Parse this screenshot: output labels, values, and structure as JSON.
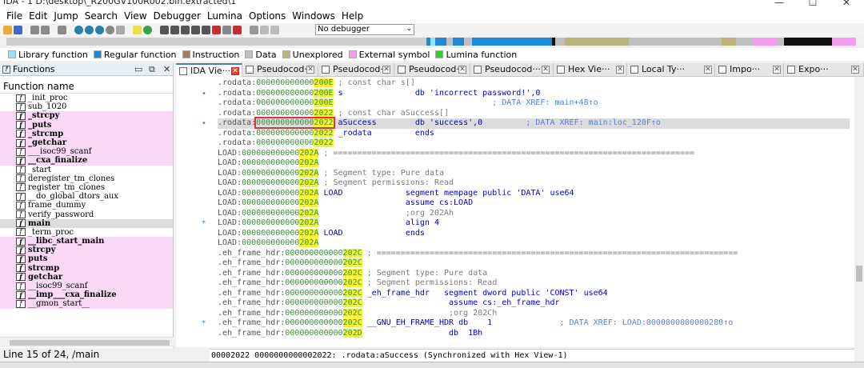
{
  "window": {
    "title": "IDA - 1 D:\\desktop\\_R200GV100R002.bin.extracted\\1",
    "minimize": "—",
    "maximize": "☐",
    "close": "✕"
  },
  "menu": [
    "File",
    "Edit",
    "Jump",
    "Search",
    "View",
    "Debugger",
    "Lumina",
    "Options",
    "Windows",
    "Help"
  ],
  "toolbar": {
    "debugger_select": "No debugger"
  },
  "legend": [
    {
      "label": "Library function",
      "color": "#8fe6f0"
    },
    {
      "label": "Regular function",
      "color": "#1e8ad6"
    },
    {
      "label": "Instruction",
      "color": "#a97a5c"
    },
    {
      "label": "Data",
      "color": "#c0c0c0"
    },
    {
      "label": "Unexplored",
      "color": "#b9b37a"
    },
    {
      "label": "External symbol",
      "color": "#f59cf0"
    },
    {
      "label": "Lumina function",
      "color": "#2fcc3c"
    }
  ],
  "functions_panel": {
    "title": "Functions",
    "column_header": "Function name",
    "items": [
      {
        "name": "_init_proc",
        "lib": false,
        "bold": false,
        "selected": false
      },
      {
        "name": "sub_1020",
        "lib": false,
        "bold": false,
        "selected": false
      },
      {
        "name": "_strcpy",
        "lib": true,
        "bold": true,
        "selected": false
      },
      {
        "name": "_puts",
        "lib": true,
        "bold": true,
        "selected": false
      },
      {
        "name": "_strcmp",
        "lib": true,
        "bold": true,
        "selected": false
      },
      {
        "name": "_getchar",
        "lib": true,
        "bold": true,
        "selected": false
      },
      {
        "name": "___isoc99_scanf",
        "lib": true,
        "bold": false,
        "selected": false
      },
      {
        "name": "__cxa_finalize",
        "lib": true,
        "bold": true,
        "selected": false
      },
      {
        "name": "_start",
        "lib": false,
        "bold": false,
        "selected": false
      },
      {
        "name": "deregister_tm_clones",
        "lib": false,
        "bold": false,
        "selected": false
      },
      {
        "name": "register_tm_clones",
        "lib": false,
        "bold": false,
        "selected": false
      },
      {
        "name": "__do_global_dtors_aux",
        "lib": false,
        "bold": false,
        "selected": false
      },
      {
        "name": "frame_dummy",
        "lib": false,
        "bold": false,
        "selected": false
      },
      {
        "name": "verify_password",
        "lib": false,
        "bold": false,
        "selected": false
      },
      {
        "name": "main",
        "lib": false,
        "bold": true,
        "selected": true
      },
      {
        "name": "_term_proc",
        "lib": false,
        "bold": false,
        "selected": false
      },
      {
        "name": "__libc_start_main",
        "lib": true,
        "bold": true,
        "selected": false
      },
      {
        "name": "strcpy",
        "lib": true,
        "bold": true,
        "selected": false
      },
      {
        "name": "puts",
        "lib": true,
        "bold": true,
        "selected": false
      },
      {
        "name": "strcmp",
        "lib": true,
        "bold": true,
        "selected": false
      },
      {
        "name": "getchar",
        "lib": true,
        "bold": true,
        "selected": false
      },
      {
        "name": "__isoc99_scanf",
        "lib": true,
        "bold": false,
        "selected": false
      },
      {
        "name": "__imp___cxa_finalize",
        "lib": true,
        "bold": true,
        "selected": false
      },
      {
        "name": "__gmon_start__",
        "lib": true,
        "bold": false,
        "selected": false
      }
    ],
    "status": "Line 15 of 24, /main"
  },
  "tabs": [
    {
      "label": "IDA Vie···",
      "active": true
    },
    {
      "label": "Pseudocod···",
      "active": false
    },
    {
      "label": "Pseudocod···",
      "active": false
    },
    {
      "label": "Pseudocod···",
      "active": false
    },
    {
      "label": "Pseudocod···",
      "active": false
    },
    {
      "label": "Hex Vie···",
      "active": false
    },
    {
      "label": "Local Ty···",
      "active": false
    },
    {
      "label": "Impo···",
      "active": false
    },
    {
      "label": "Expo···",
      "active": false
    }
  ],
  "disasm": {
    "lines": [
      {
        "mark": "",
        "seg": ".rodata:",
        "addr": "000000000000200E",
        "rest": " ; const char s[]",
        "type": "plain"
      },
      {
        "mark": "•",
        "seg": ".rodata:",
        "addr": "000000000000200E",
        "label": " s",
        "pad": "               ",
        "op": "db 'incorrect password!',0",
        "xref": "",
        "type": "data"
      },
      {
        "mark": "",
        "seg": ".rodata:",
        "addr": "000000000000200E",
        "rest": "",
        "xref": "                                 ; DATA XREF: main+48↑o",
        "type": "xref"
      },
      {
        "mark": "",
        "seg": ".rodata:",
        "addr": "0000000000002022",
        "rest": " ; const char aSuccess[]",
        "type": "plain"
      },
      {
        "mark": "•",
        "seg": ".rodata:",
        "addr": "0000000000002022",
        "label": " aSuccess",
        "pad": "        ",
        "op": "db 'success',0",
        "xref": "         ; DATA XREF: main:loc_120F↑o",
        "type": "current"
      },
      {
        "mark": "",
        "seg": ".rodata:",
        "addr": "0000000000002022",
        "label": " _rodata",
        "pad": "         ",
        "op": "ends",
        "xref": "",
        "type": "data"
      },
      {
        "mark": "",
        "seg": ".rodata:",
        "addr": "0000000000002022",
        "rest": "",
        "type": "plain"
      },
      {
        "mark": "",
        "seg": "LOAD:",
        "addr": "000000000000202A",
        "rest": " ; ===========================================================================",
        "type": "plain"
      },
      {
        "mark": "",
        "seg": "LOAD:",
        "addr": "000000000000202A",
        "rest": "",
        "type": "plain"
      },
      {
        "mark": "",
        "seg": "LOAD:",
        "addr": "000000000000202A",
        "rest": " ; Segment type: Pure data",
        "type": "plain"
      },
      {
        "mark": "",
        "seg": "LOAD:",
        "addr": "000000000000202A",
        "rest": " ; Segment permissions: Read",
        "type": "plain"
      },
      {
        "mark": "",
        "seg": "LOAD:",
        "addr": "000000000000202A",
        "label": " LOAD",
        "pad": "             ",
        "op": "segment mempage public 'DATA' use64",
        "xref": "",
        "type": "data"
      },
      {
        "mark": "",
        "seg": "LOAD:",
        "addr": "000000000000202A",
        "label": "",
        "pad": "                  ",
        "op": "assume cs:LOAD",
        "xref": "",
        "type": "data"
      },
      {
        "mark": "",
        "seg": "LOAD:",
        "addr": "000000000000202A",
        "label": "",
        "pad": "                  ",
        "op": ";org 202Ah",
        "xref": "",
        "type": "comment"
      },
      {
        "mark": "*",
        "seg": "LOAD:",
        "addr": "000000000000202A",
        "label": "",
        "pad": "                  ",
        "op": "align 4",
        "xref": "",
        "type": "data"
      },
      {
        "mark": "",
        "seg": "LOAD:",
        "addr": "000000000000202A",
        "label": " LOAD",
        "pad": "             ",
        "op": "ends",
        "xref": "",
        "type": "data"
      },
      {
        "mark": "",
        "seg": "LOAD:",
        "addr": "000000000000202A",
        "rest": "",
        "type": "plain"
      },
      {
        "mark": "",
        "seg": ".eh_frame_hdr:",
        "addr": "000000000000202C",
        "rest": " ; ===========================================================================",
        "type": "plain"
      },
      {
        "mark": "",
        "seg": ".eh_frame_hdr:",
        "addr": "000000000000202C",
        "rest": "",
        "type": "plain"
      },
      {
        "mark": "",
        "seg": ".eh_frame_hdr:",
        "addr": "000000000000202C",
        "rest": " ; Segment type: Pure data",
        "type": "plain"
      },
      {
        "mark": "",
        "seg": ".eh_frame_hdr:",
        "addr": "000000000000202C",
        "rest": " ; Segment permissions: Read",
        "type": "plain"
      },
      {
        "mark": "",
        "seg": ".eh_frame_hdr:",
        "addr": "000000000000202C",
        "label": " _eh_frame_hdr",
        "pad": "   ",
        "op": "segment dword public 'CONST' use64",
        "xref": "",
        "type": "data"
      },
      {
        "mark": "",
        "seg": ".eh_frame_hdr:",
        "addr": "000000000000202C",
        "label": "",
        "pad": "                  ",
        "op": "assume cs:_eh_frame_hdr",
        "xref": "",
        "type": "data"
      },
      {
        "mark": "",
        "seg": ".eh_frame_hdr:",
        "addr": "000000000000202C",
        "label": "",
        "pad": "                  ",
        "op": ";org 202Ch",
        "xref": "",
        "type": "comment"
      },
      {
        "mark": "*",
        "seg": ".eh_frame_hdr:",
        "addr": "000000000000202C",
        "label": " __GNU_EH_FRAME_HDR",
        "pad": " ",
        "op": "db    1",
        "xref": "              ; DATA XREF: LOAD:0000000000000280↑o",
        "type": "data"
      },
      {
        "mark": "",
        "seg": ".eh_frame_hdr:",
        "addr": "000000000000202D",
        "label": "",
        "pad": "                  ",
        "op": "db  1Bh",
        "xref": "",
        "type": "data"
      }
    ],
    "sync_status": "00002022 0000000000002022: .rodata:aSuccess (Synchronized with Hex View-1)"
  }
}
